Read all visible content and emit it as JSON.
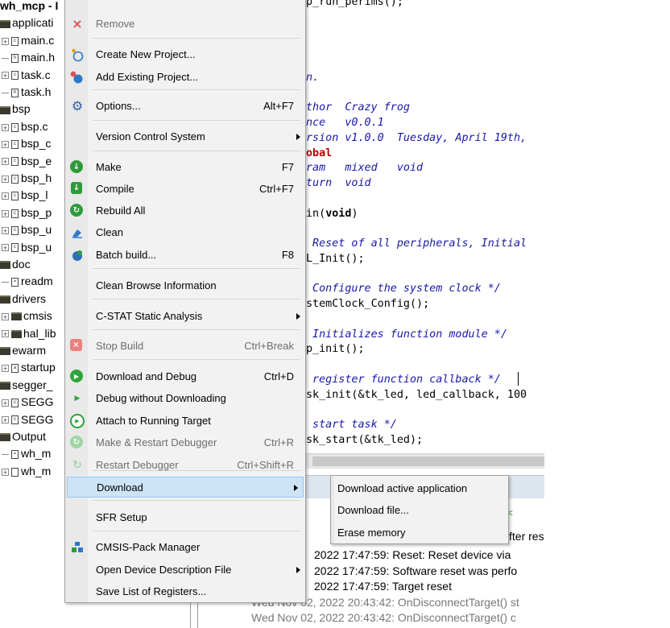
{
  "tree": {
    "items": [
      {
        "label": "wh_mcp - I",
        "kind": "root",
        "bold": true
      },
      {
        "label": "applicati",
        "kind": "folder"
      },
      {
        "label": "main.c",
        "kind": "file",
        "glyph": "c",
        "expand": "+"
      },
      {
        "label": "main.h",
        "kind": "file",
        "glyph": "h",
        "expand": "-"
      },
      {
        "label": "task.c",
        "kind": "file",
        "glyph": "c",
        "expand": "+"
      },
      {
        "label": "task.h",
        "kind": "file",
        "glyph": "h",
        "expand": "-"
      },
      {
        "label": "bsp",
        "kind": "folder"
      },
      {
        "label": "bsp.c",
        "kind": "file",
        "glyph": "c",
        "expand": "+"
      },
      {
        "label": "bsp_c",
        "kind": "file",
        "glyph": "c",
        "expand": "+"
      },
      {
        "label": "bsp_e",
        "kind": "file",
        "glyph": "c",
        "expand": "+"
      },
      {
        "label": "bsp_h",
        "kind": "file",
        "glyph": "c",
        "expand": "+"
      },
      {
        "label": "bsp_l",
        "kind": "file",
        "glyph": "c",
        "expand": "+"
      },
      {
        "label": "bsp_p",
        "kind": "file",
        "glyph": "c",
        "expand": "+"
      },
      {
        "label": "bsp_u",
        "kind": "file",
        "glyph": "c",
        "expand": "+"
      },
      {
        "label": "bsp_u",
        "kind": "file",
        "glyph": "c",
        "expand": "+"
      },
      {
        "label": "doc",
        "kind": "folder"
      },
      {
        "label": "readm",
        "kind": "file",
        "glyph": "=",
        "expand": "-"
      },
      {
        "label": "drivers",
        "kind": "folder"
      },
      {
        "label": "cmsis",
        "kind": "folder",
        "expand": "+"
      },
      {
        "label": "hal_lib",
        "kind": "folder",
        "expand": "+"
      },
      {
        "label": "ewarm",
        "kind": "folder"
      },
      {
        "label": "startup",
        "kind": "file",
        "glyph": "a",
        "expand": "+"
      },
      {
        "label": "segger_",
        "kind": "folder"
      },
      {
        "label": "SEGG",
        "kind": "file",
        "glyph": "c",
        "expand": "+"
      },
      {
        "label": "SEGG",
        "kind": "file",
        "glyph": "c",
        "expand": "+"
      },
      {
        "label": "Output",
        "kind": "folder"
      },
      {
        "label": "wh_m",
        "kind": "file",
        "glyph": "=",
        "expand": "-"
      },
      {
        "label": "wh_m",
        "kind": "file",
        "glyph": "",
        "expand": "+"
      }
    ]
  },
  "editor": {
    "lines": [
      {
        "segments": [
          {
            "t": "p_run_perims();",
            "c": ""
          }
        ]
      },
      {
        "segments": [
          {
            "t": "",
            "c": ""
          }
        ]
      },
      {
        "segments": [
          {
            "t": "",
            "c": ""
          }
        ]
      },
      {
        "segments": [
          {
            "t": "",
            "c": ""
          }
        ]
      },
      {
        "segments": [
          {
            "t": "",
            "c": ""
          }
        ]
      },
      {
        "segments": [
          {
            "t": "n.",
            "c": "cmt"
          }
        ]
      },
      {
        "segments": [
          {
            "t": "",
            "c": ""
          }
        ]
      },
      {
        "segments": [
          {
            "t": "thor  Crazy frog",
            "c": "cmt"
          }
        ]
      },
      {
        "segments": [
          {
            "t": "nce   v0.0.1",
            "c": "cmt"
          }
        ]
      },
      {
        "segments": [
          {
            "t": "rsion v1.0.0  Tuesday, April 19th,",
            "c": "cmt"
          }
        ]
      },
      {
        "segments": [
          {
            "t": "obal",
            "c": "kw-red"
          }
        ]
      },
      {
        "segments": [
          {
            "t": "ram   mixed   void",
            "c": "cmt"
          }
        ]
      },
      {
        "segments": [
          {
            "t": "turn  void",
            "c": "cmt"
          }
        ]
      },
      {
        "segments": [
          {
            "t": "",
            "c": ""
          }
        ]
      },
      {
        "segments": [
          {
            "t": "in(",
            "c": ""
          },
          {
            "t": "void",
            "c": "bold"
          },
          {
            "t": ")",
            "c": ""
          }
        ]
      },
      {
        "segments": [
          {
            "t": "",
            "c": ""
          }
        ]
      },
      {
        "segments": [
          {
            "t": " Reset of all peripherals, Initial",
            "c": "cmt"
          }
        ]
      },
      {
        "segments": [
          {
            "t": "L_Init();",
            "c": ""
          }
        ]
      },
      {
        "segments": [
          {
            "t": "",
            "c": ""
          }
        ]
      },
      {
        "segments": [
          {
            "t": " Configure the system clock */",
            "c": "cmt"
          }
        ]
      },
      {
        "segments": [
          {
            "t": "stemClock_Config();",
            "c": ""
          }
        ]
      },
      {
        "segments": [
          {
            "t": "",
            "c": ""
          }
        ]
      },
      {
        "segments": [
          {
            "t": " Initializes function module */",
            "c": "cmt"
          }
        ]
      },
      {
        "segments": [
          {
            "t": "p_init();",
            "c": ""
          }
        ]
      },
      {
        "segments": [
          {
            "t": "",
            "c": ""
          }
        ]
      },
      {
        "segments": [
          {
            "t": " register function callback */",
            "c": "cmt"
          }
        ]
      },
      {
        "segments": [
          {
            "t": "sk_init(&tk_led, led_callback, 100",
            "c": ""
          }
        ]
      },
      {
        "segments": [
          {
            "t": "",
            "c": ""
          }
        ]
      },
      {
        "segments": [
          {
            "t": " start task */",
            "c": "cmt"
          }
        ]
      },
      {
        "segments": [
          {
            "t": "sk_start(&tk_led);",
            "c": ""
          }
        ]
      }
    ]
  },
  "log": {
    "green_text": "<",
    "partial_text": "fter res",
    "lines": [
      "2022 17:47:59: Reset: Reset device via",
      "2022 17:47:59: Software reset was perfo",
      "2022 17:47:59: Target reset",
      "Wed Nov 02, 2022 20:43:42: OnDisconnectTarget() st",
      "Wed Nov 02, 2022 20:43:42: OnDisconnectTarget() c"
    ]
  },
  "menu": {
    "items": [
      {
        "label": "Remove",
        "icon": "remove-icon",
        "disabled": true
      },
      {
        "label": "Create New Project...",
        "icon": "create-project-icon"
      },
      {
        "label": "Add Existing Project...",
        "icon": "add-project-icon"
      },
      {
        "label": "Options...",
        "icon": "gear-icon",
        "shortcut": "Alt+F7"
      },
      {
        "label": "Version Control System",
        "submenu": true
      },
      {
        "label": "Make",
        "icon": "make-icon",
        "shortcut": "F7"
      },
      {
        "label": "Compile",
        "icon": "compile-icon",
        "shortcut": "Ctrl+F7"
      },
      {
        "label": "Rebuild All",
        "icon": "rebuild-icon"
      },
      {
        "label": "Clean",
        "icon": "clean-icon"
      },
      {
        "label": "Batch build...",
        "icon": "batch-build-icon",
        "shortcut": "F8"
      },
      {
        "label": "Clean Browse Information"
      },
      {
        "label": "C-STAT Static Analysis",
        "submenu": true
      },
      {
        "label": "Stop Build",
        "icon": "stop-build-icon",
        "shortcut": "Ctrl+Break",
        "disabled": true
      },
      {
        "label": "Download and Debug",
        "icon": "download-debug-icon",
        "shortcut": "Ctrl+D"
      },
      {
        "label": "Debug without Downloading",
        "icon": "debug-no-download-icon"
      },
      {
        "label": "Attach to Running Target",
        "icon": "attach-target-icon"
      },
      {
        "label": "Make & Restart Debugger",
        "icon": "make-restart-icon",
        "shortcut": "Ctrl+R",
        "disabled": true
      },
      {
        "label": "Restart Debugger",
        "icon": "restart-debugger-icon",
        "shortcut": "Ctrl+Shift+R",
        "disabled": true
      },
      {
        "label": "Download",
        "submenu": true,
        "highlighted": true
      },
      {
        "label": "SFR Setup"
      },
      {
        "label": "CMSIS-Pack Manager",
        "icon": "cmsis-pack-icon"
      },
      {
        "label": "Open Device Description File",
        "submenu": true
      },
      {
        "label": "Save List of Registers..."
      }
    ]
  },
  "submenu": {
    "items": [
      {
        "label": "Download active application"
      },
      {
        "label": "Download file..."
      },
      {
        "label": "Erase memory"
      }
    ]
  },
  "colors": {
    "green": "#2fa43a",
    "blue": "#2f78c8",
    "red": "#e05050",
    "highlight": "#cde4f7"
  }
}
